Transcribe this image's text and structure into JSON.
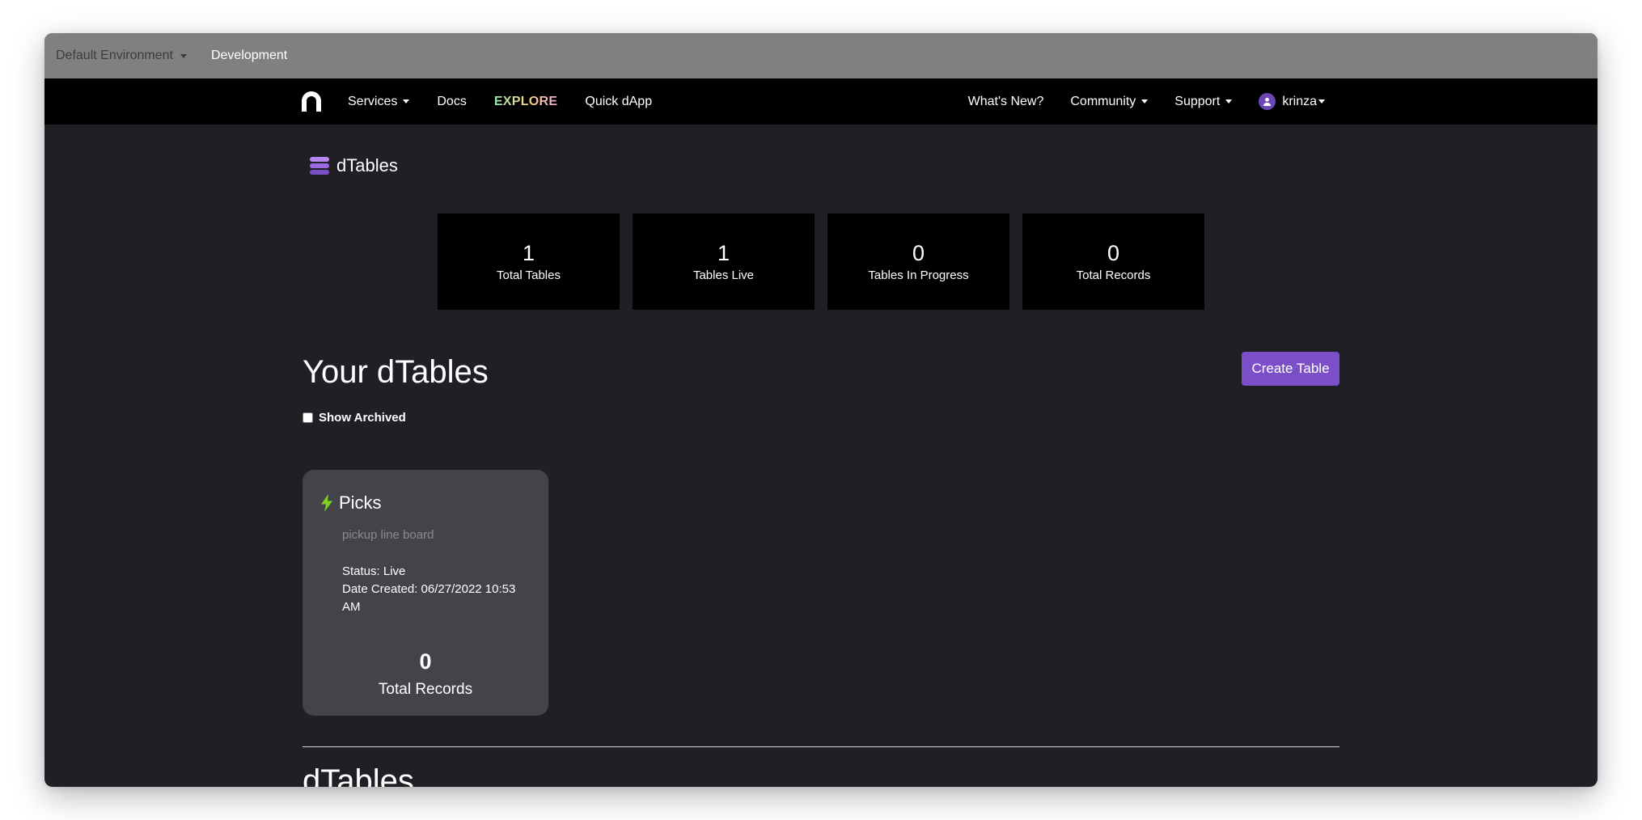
{
  "env_bar": {
    "environment": "Default Environment",
    "active": "Development"
  },
  "nav": {
    "left": [
      "Services",
      "Docs",
      "EXPLORE",
      "Quick dApp"
    ],
    "right": [
      "What's New?",
      "Community",
      "Support"
    ],
    "user": "krinza"
  },
  "page": {
    "title": "dTables"
  },
  "stats": [
    {
      "value": "1",
      "label": "Total Tables"
    },
    {
      "value": "1",
      "label": "Tables Live"
    },
    {
      "value": "0",
      "label": "Tables In Progress"
    },
    {
      "value": "0",
      "label": "Total Records"
    }
  ],
  "section": {
    "title": "Your dTables",
    "create_button": "Create Table",
    "show_archived": "Show Archived"
  },
  "tables": [
    {
      "name": "Picks",
      "description": "pickup line board",
      "status": "Status: Live",
      "date_created": "Date Created: 06/27/2022 10:53 AM",
      "records_count": "0",
      "records_label": "Total Records"
    }
  ],
  "bottom": {
    "title": "dTables"
  },
  "colors": {
    "accent": "#7b4fc8",
    "live_icon": "#7ed321",
    "background": "#211f26",
    "card": "#45434a"
  }
}
